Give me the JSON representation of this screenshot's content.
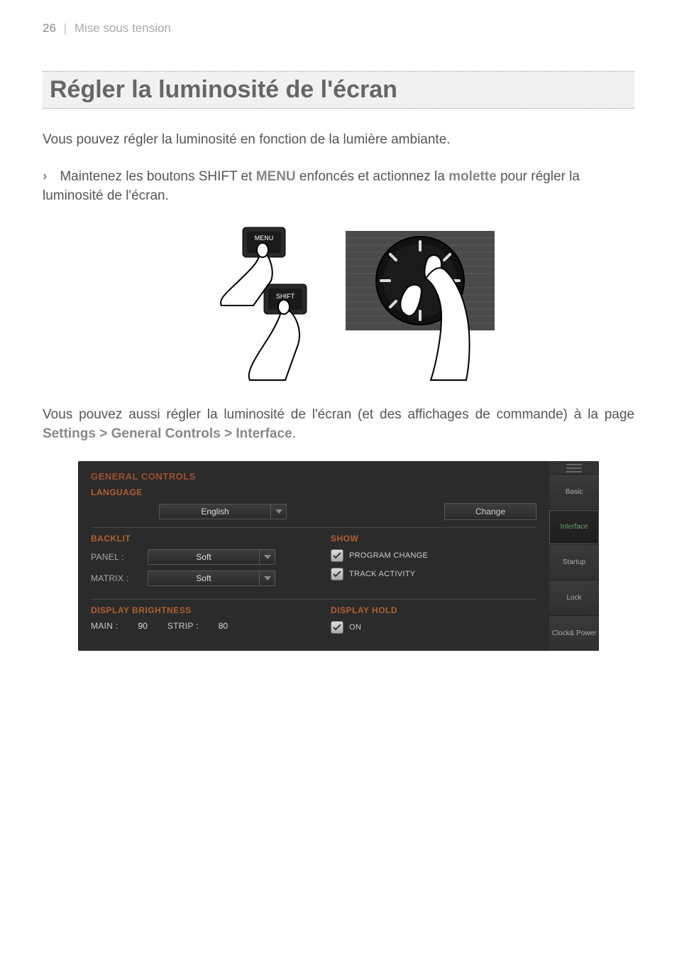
{
  "header": {
    "page_number": "26",
    "divider": "|",
    "section": "Mise sous tension"
  },
  "title": "Régler la luminosité de l'écran",
  "para1": "Vous pouvez régler la luminosité en fonction de la lumière ambiante.",
  "instruction": {
    "chevron": "›",
    "pre": "Maintenez les boutons SHIFT et ",
    "menu": "MENU",
    "mid": " enfoncés et actionnez la ",
    "molette": "molette",
    "post": " pour régler la luminosité de l'écran."
  },
  "illus": {
    "menu_label": "MENU",
    "shift_label": "SHIFT"
  },
  "para2": {
    "pre": "Vous pouvez aussi régler la luminosité de l'écran (et des affichages de commande) à la page ",
    "path": "Settings > General Controls > Interface",
    "post": "."
  },
  "settings": {
    "title": "GENERAL CONTROLS",
    "language": {
      "label": "LANGUAGE",
      "value": "English",
      "change_btn": "Change"
    },
    "backlit": {
      "label": "BACKLIT",
      "panel_label": "PANEL :",
      "panel_value": "Soft",
      "matrix_label": "MATRIX :",
      "matrix_value": "Soft"
    },
    "show": {
      "label": "SHOW",
      "program_change": "PROGRAM CHANGE",
      "track_activity": "TRACK ACTIVITY"
    },
    "display_brightness": {
      "label": "DISPLAY BRIGHTNESS",
      "main_label": "MAIN :",
      "main_value": "90",
      "strip_label": "STRIP :",
      "strip_value": "80"
    },
    "display_hold": {
      "label": "DISPLAY HOLD",
      "on": "ON"
    },
    "tabs": [
      "Basic",
      "Interface",
      "Startup",
      "Lock",
      "Clock& Power"
    ],
    "active_tab": 1
  },
  "chart_data": {
    "type": "table",
    "data": {
      "LANGUAGE": "English",
      "BACKLIT_PANEL": "Soft",
      "BACKLIT_MATRIX": "Soft",
      "SHOW_PROGRAM_CHANGE": true,
      "SHOW_TRACK_ACTIVITY": true,
      "DISPLAY_BRIGHTNESS_MAIN": 90,
      "DISPLAY_BRIGHTNESS_STRIP": 80,
      "DISPLAY_HOLD_ON": true
    }
  }
}
